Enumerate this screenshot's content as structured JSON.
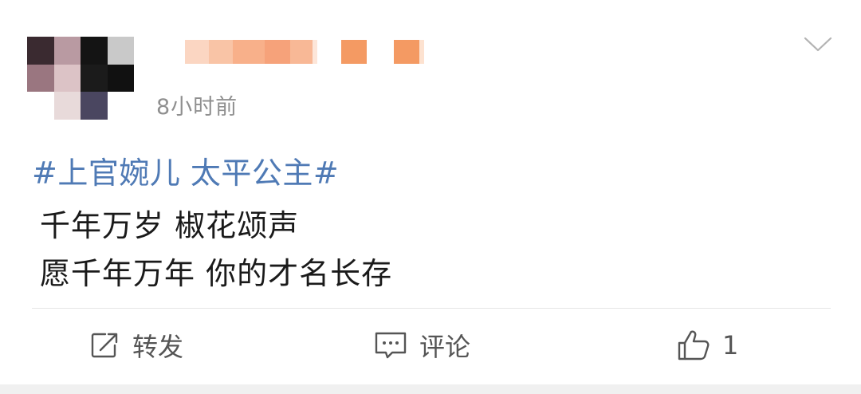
{
  "post": {
    "timestamp": "8小时前",
    "hashtag": "#上官婉儿 太平公主#",
    "content_lines": [
      "千年万岁 椒花颂声",
      "愿千年万年 你的才名长存"
    ]
  },
  "actions": {
    "repost_label": "转发",
    "comment_label": "评论",
    "like_count": "1"
  },
  "icons": {
    "menu": "chevron-down-icon",
    "repost": "repost-icon",
    "comment": "comment-icon",
    "like": "thumbs-up-icon"
  },
  "colors": {
    "hashtag": "#4f7ab5",
    "text": "#1a1a1a",
    "muted": "#8f8f8f",
    "action": "#555555"
  }
}
